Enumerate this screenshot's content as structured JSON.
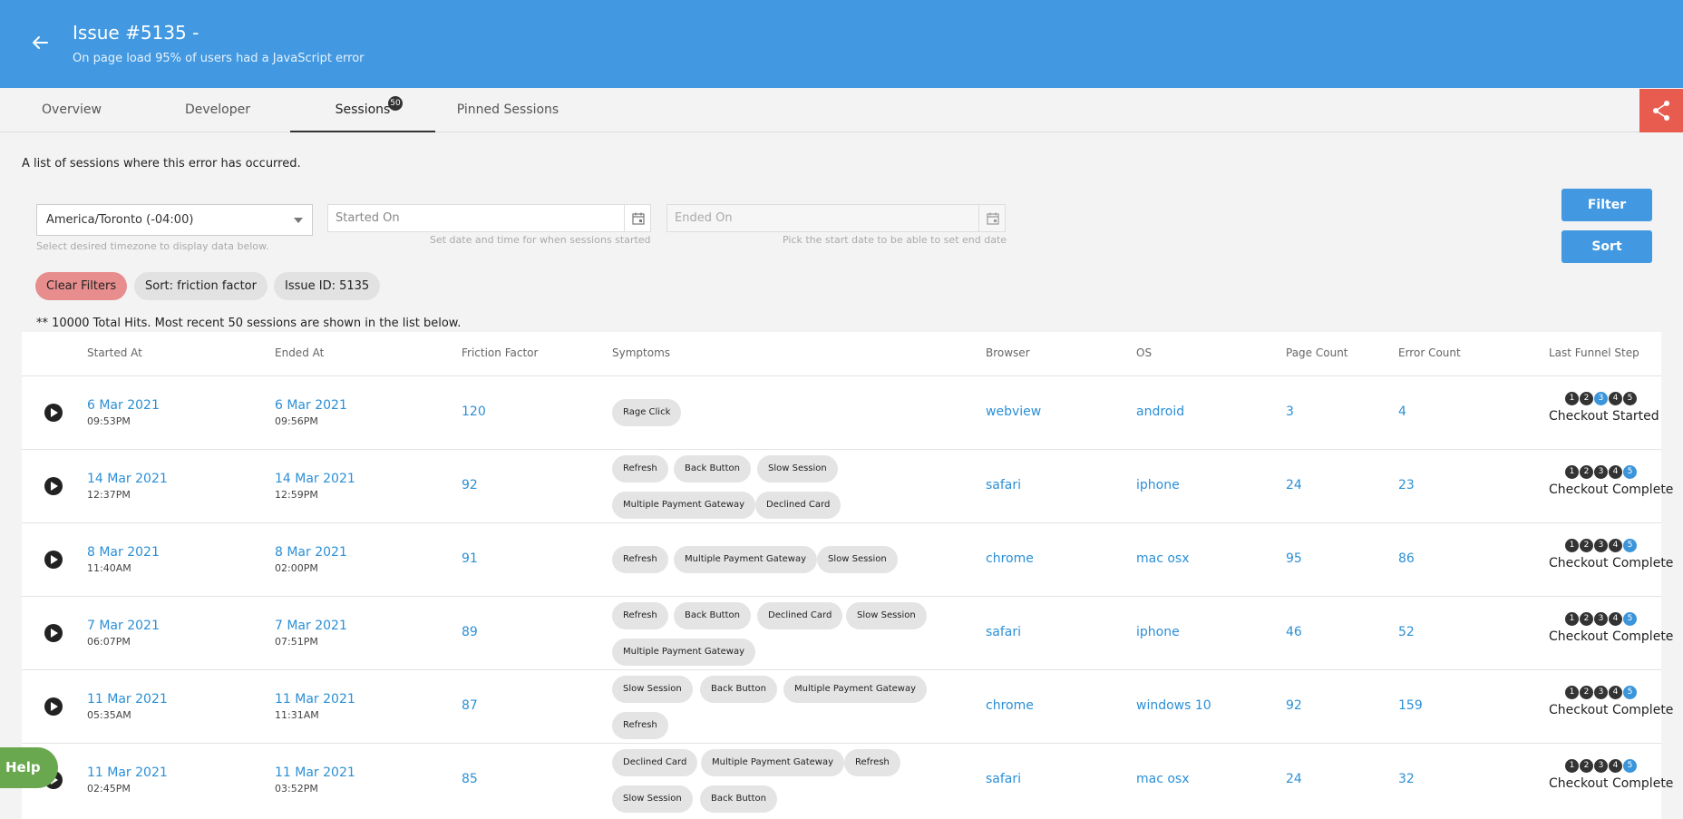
{
  "header": {
    "title": "Issue #5135 -",
    "subtitle": "On page load 95% of users had a JavaScript error",
    "bg_color": "#4299e1"
  },
  "tabs": [
    {
      "label": "Overview"
    },
    {
      "label": "Developer"
    },
    {
      "label": "Sessions",
      "badge": "50",
      "active": true
    },
    {
      "label": "Pinned Sessions"
    }
  ],
  "intro_text": "A list of sessions where this error has occurred.",
  "filters": {
    "timezone_value": "America/Toronto (-04:00)",
    "timezone_help": "Select desired timezone to display data below.",
    "started_placeholder": "Started On",
    "started_help": "Set date and time for when sessions started",
    "ended_placeholder": "Ended On",
    "ended_help": "Pick the start date to be able to set end date",
    "filter_label": "Filter",
    "sort_label": "Sort"
  },
  "chips": {
    "clear": "Clear Filters",
    "sort": "Sort: friction factor",
    "issue": "Issue ID: 5135"
  },
  "hits_text": "** 10000 Total Hits. Most recent 50 sessions are shown in the list below.",
  "table": {
    "headers": {
      "started": "Started At",
      "ended": "Ended At",
      "friction": "Friction Factor",
      "symptoms": "Symptoms",
      "browser": "Browser",
      "os": "OS",
      "pages": "Page Count",
      "errors": "Error Count",
      "funnel": "Last Funnel Step"
    },
    "rows": [
      {
        "start_date": "6 Mar 2021",
        "start_time": "09:53PM",
        "end_date": "6 Mar 2021",
        "end_time": "09:56PM",
        "friction": "120",
        "symptoms": [
          [
            "Rage Click"
          ]
        ],
        "browser": "webview",
        "os": "android",
        "pages": "3",
        "errors": "4",
        "funnel_step": 3,
        "funnel_label": "Checkout Started"
      },
      {
        "start_date": "14 Mar 2021",
        "start_time": "12:37PM",
        "end_date": "14 Mar 2021",
        "end_time": "12:59PM",
        "friction": "92",
        "symptoms": [
          [
            "Refresh",
            "Back Button",
            "Slow Session"
          ],
          [
            "Multiple Payment Gateway",
            "Declined Card"
          ]
        ],
        "browser": "safari",
        "os": "iphone",
        "pages": "24",
        "errors": "23",
        "funnel_step": 5,
        "funnel_label": "Checkout Complete"
      },
      {
        "start_date": "8 Mar 2021",
        "start_time": "11:40AM",
        "end_date": "8 Mar 2021",
        "end_time": "02:00PM",
        "friction": "91",
        "symptoms": [
          [
            "Refresh",
            "Multiple Payment Gateway",
            "Slow Session"
          ]
        ],
        "browser": "chrome",
        "os": "mac osx",
        "pages": "95",
        "errors": "86",
        "funnel_step": 5,
        "funnel_label": "Checkout Complete"
      },
      {
        "start_date": "7 Mar 2021",
        "start_time": "06:07PM",
        "end_date": "7 Mar 2021",
        "end_time": "07:51PM",
        "friction": "89",
        "symptoms": [
          [
            "Refresh",
            "Back Button",
            "Declined Card",
            "Slow Session"
          ],
          [
            "Multiple Payment Gateway"
          ]
        ],
        "browser": "safari",
        "os": "iphone",
        "pages": "46",
        "errors": "52",
        "funnel_step": 5,
        "funnel_label": "Checkout Complete"
      },
      {
        "start_date": "11 Mar 2021",
        "start_time": "05:35AM",
        "end_date": "11 Mar 2021",
        "end_time": "11:31AM",
        "friction": "87",
        "symptoms": [
          [
            "Slow Session",
            "Back Button",
            "Multiple Payment Gateway"
          ],
          [
            "Refresh"
          ]
        ],
        "browser": "chrome",
        "os": "windows 10",
        "pages": "92",
        "errors": "159",
        "funnel_step": 5,
        "funnel_label": "Checkout Complete"
      },
      {
        "start_date": "11 Mar 2021",
        "start_time": "02:45PM",
        "end_date": "11 Mar 2021",
        "end_time": "03:52PM",
        "friction": "85",
        "symptoms": [
          [
            "Declined Card",
            "Multiple Payment Gateway",
            "Refresh"
          ],
          [
            "Slow Session",
            "Back Button"
          ]
        ],
        "browser": "safari",
        "os": "mac osx",
        "pages": "24",
        "errors": "32",
        "funnel_step": 5,
        "funnel_label": "Checkout Complete"
      }
    ]
  },
  "help_label": "Help"
}
